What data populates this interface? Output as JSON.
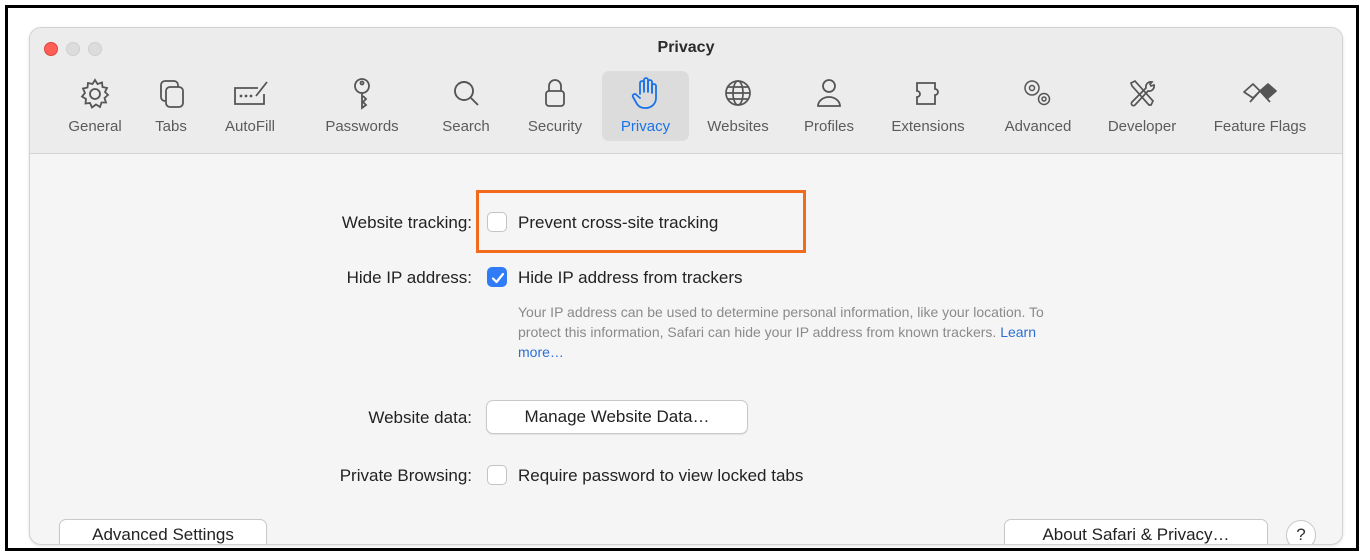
{
  "window": {
    "title": "Privacy"
  },
  "toolbar": {
    "items": [
      {
        "label": "General",
        "icon": "gear-icon"
      },
      {
        "label": "Tabs",
        "icon": "tabs-icon"
      },
      {
        "label": "AutoFill",
        "icon": "autofill-icon"
      },
      {
        "label": "Passwords",
        "icon": "key-icon"
      },
      {
        "label": "Search",
        "icon": "search-icon"
      },
      {
        "label": "Security",
        "icon": "lock-icon"
      },
      {
        "label": "Privacy",
        "icon": "hand-icon",
        "selected": true
      },
      {
        "label": "Websites",
        "icon": "globe-icon"
      },
      {
        "label": "Profiles",
        "icon": "person-icon"
      },
      {
        "label": "Extensions",
        "icon": "puzzle-icon"
      },
      {
        "label": "Advanced",
        "icon": "gears-icon"
      },
      {
        "label": "Developer",
        "icon": "wrench-screwdriver-icon"
      },
      {
        "label": "Feature Flags",
        "icon": "flags-icon"
      }
    ]
  },
  "settings": {
    "website_tracking": {
      "label": "Website tracking:",
      "option": "Prevent cross-site tracking",
      "checked": false
    },
    "hide_ip": {
      "label": "Hide IP address:",
      "option": "Hide IP address from trackers",
      "checked": true
    },
    "hide_ip_help": "Your IP address can be used to determine personal information, like your location. To protect this information, Safari can hide your IP address from known trackers.",
    "learn_more": "Learn more…",
    "website_data": {
      "label": "Website data:",
      "button": "Manage Website Data…"
    },
    "private_browsing": {
      "label": "Private Browsing:",
      "option": "Require password to view locked tabs",
      "checked": false
    }
  },
  "footer": {
    "advanced_button": "Advanced Settings",
    "about_button": "About Safari & Privacy…",
    "help_button": "?"
  },
  "colors": {
    "accent": "#2f7cf6",
    "highlight": "#f26b1d",
    "close": "#ff5f57"
  }
}
